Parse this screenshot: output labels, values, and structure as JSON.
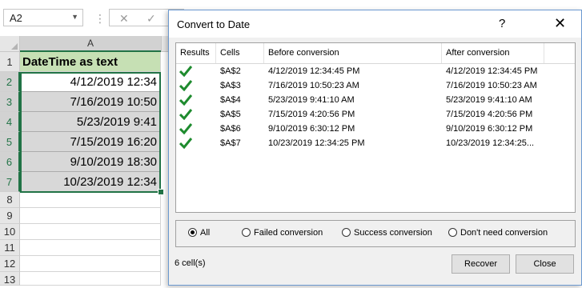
{
  "excel": {
    "name_box": "A2",
    "formula_icons": {
      "cancel": "✕",
      "enter": "✓"
    },
    "column_header": "A",
    "rows": [
      {
        "num": "1",
        "text": "DateTime as text"
      },
      {
        "num": "2",
        "text": "4/12/2019 12:34"
      },
      {
        "num": "3",
        "text": "7/16/2019 10:50"
      },
      {
        "num": "4",
        "text": "5/23/2019 9:41"
      },
      {
        "num": "5",
        "text": "7/15/2019 16:20"
      },
      {
        "num": "6",
        "text": "9/10/2019 18:30"
      },
      {
        "num": "7",
        "text": "10/23/2019 12:34"
      },
      {
        "num": "8",
        "text": ""
      },
      {
        "num": "9",
        "text": ""
      },
      {
        "num": "10",
        "text": ""
      },
      {
        "num": "11",
        "text": ""
      },
      {
        "num": "12",
        "text": ""
      },
      {
        "num": "13",
        "text": ""
      }
    ]
  },
  "dialog": {
    "title": "Convert to Date",
    "help": "?",
    "close": "✕",
    "columns": [
      "Results",
      "Cells",
      "Before conversion",
      "After conversion"
    ],
    "rows": [
      {
        "cell": "$A$2",
        "before": "4/12/2019  12:34:45 PM",
        "after": "4/12/2019 12:34:45 PM"
      },
      {
        "cell": "$A$3",
        "before": "7/16/2019  10:50:23 AM",
        "after": "7/16/2019 10:50:23 AM"
      },
      {
        "cell": "$A$4",
        "before": "5/23/2019  9:41:10 AM",
        "after": "5/23/2019 9:41:10 AM"
      },
      {
        "cell": "$A$5",
        "before": "7/15/2019  4:20:56 PM",
        "after": "7/15/2019 4:20:56 PM"
      },
      {
        "cell": "$A$6",
        "before": "9/10/2019  6:30:12 PM",
        "after": "9/10/2019 6:30:12 PM"
      },
      {
        "cell": "$A$7",
        "before": "10/23/2019  12:34:25 PM",
        "after": "10/23/2019 12:34:25..."
      }
    ],
    "filters": {
      "all": "All",
      "failed": "Failed conversion",
      "success": "Success conversion",
      "dont_need": "Don't need conversion",
      "selected": "all"
    },
    "status": "6 cell(s)",
    "recover_label": "Recover",
    "close_label": "Close",
    "check_color": "#1e8b2e"
  }
}
